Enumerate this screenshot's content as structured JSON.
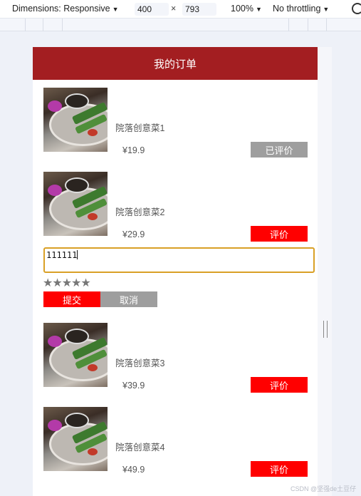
{
  "devtools": {
    "dimensions_label": "Dimensions: Responsive",
    "width": "400",
    "times": "×",
    "height": "793",
    "zoom": "100%",
    "throttling": "No throttling"
  },
  "page": {
    "title": "我的订单"
  },
  "orders": [
    {
      "name": "院落创意菜1",
      "price": "¥19.9",
      "action": "已评价",
      "action_color": "#9e9e9e"
    },
    {
      "name": "院落创意菜2",
      "price": "¥29.9",
      "action": "评价",
      "action_color": "#ff0000"
    },
    {
      "name": "院落创意菜3",
      "price": "¥39.9",
      "action": "评价",
      "action_color": "#ff0000"
    },
    {
      "name": "院落创意菜4",
      "price": "¥49.9",
      "action": "评价",
      "action_color": "#ff0000"
    }
  ],
  "review": {
    "input_value": "111111",
    "stars": "★★★★★",
    "rating": 0,
    "submit_label": "提交",
    "cancel_label": "取消"
  },
  "watermark": "CSDN @坚强de土豆仔",
  "colors": {
    "header": "#a31e21",
    "primary_button": "#ff0000",
    "secondary_button": "#9e9e9e",
    "input_border": "#d9a026"
  }
}
